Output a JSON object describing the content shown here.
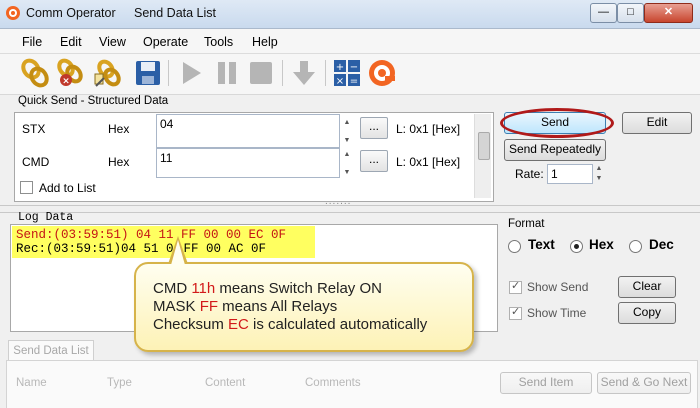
{
  "window": {
    "app_title": "Comm Operator",
    "doc_title": "Send Data List",
    "minimize": "—",
    "maximize": "□",
    "close": "✕"
  },
  "menu": [
    "File",
    "Edit",
    "View",
    "Operate",
    "Tools",
    "Help"
  ],
  "toolbar": {
    "icons": [
      "connect-chain-icon",
      "disconnect-chain-icon",
      "edit-connection-icon",
      "save-icon",
      "play-icon",
      "pause-icon",
      "stop-icon",
      "download-arrow-icon",
      "calculator-icon",
      "app-logo-icon"
    ],
    "colors": {
      "gold": "#d9a321",
      "save_blue": "#2b5fa6",
      "disabled_gray": "#b5b5b5",
      "logo_orange": "#f26522"
    }
  },
  "quick_send": {
    "label": "Quick Send - Structured Data",
    "rows": [
      {
        "name": "STX",
        "format": "Hex",
        "value": "04",
        "ellipsis": "...",
        "length": "L:  0x1 [Hex]"
      },
      {
        "name": "CMD",
        "format": "Hex",
        "value": "11",
        "ellipsis": "...",
        "length": "L:  0x1 [Hex]"
      }
    ],
    "add_to_list": "Add to List",
    "buttons": {
      "send": "Send",
      "edit": "Edit",
      "send_repeatedly": "Send Repeatedly"
    },
    "rate_label": "Rate:",
    "rate_value": "1"
  },
  "log": {
    "label": "Log Data",
    "send_line": "Send:(03:59:51) 04 11 FF 00 00 EC 0F",
    "rec_prefix": "Rec:(03:59:51)04 51 0",
    "rec_suffix": "FF 00 AC 0F"
  },
  "format": {
    "label": "Format",
    "options": [
      "Text",
      "Hex",
      "Dec"
    ],
    "selected": "Hex",
    "show_send": "Show Send",
    "show_time": "Show Time",
    "clear": "Clear",
    "copy": "Copy"
  },
  "callout": {
    "line1": {
      "a": "CMD ",
      "b": "11h",
      "c": " means Switch Relay ON"
    },
    "line2": {
      "a": "MASK ",
      "b": "FF",
      "c": " means All Relays"
    },
    "line3": {
      "a": "Checksum ",
      "b": "EC",
      "c": " is calculated automatically"
    },
    "highlight_color": "#d21a1a"
  },
  "bottom": {
    "tab": "Send Data List",
    "columns": [
      "Name",
      "Type",
      "Content",
      "Comments"
    ],
    "buttons": [
      "Send Item",
      "Send & Go Next"
    ]
  }
}
